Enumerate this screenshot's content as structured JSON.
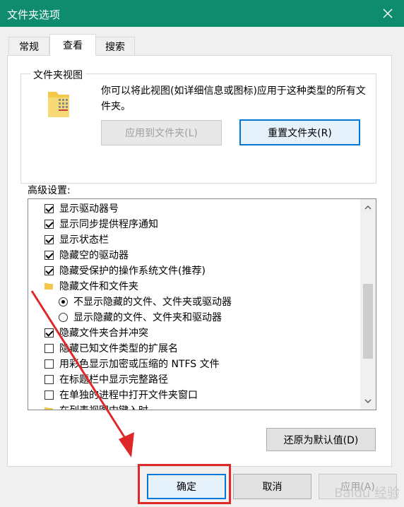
{
  "window": {
    "title": "文件夹选项"
  },
  "tabs": [
    {
      "label": "常规"
    },
    {
      "label": "查看"
    },
    {
      "label": "搜索"
    }
  ],
  "folder_views": {
    "legend": "文件夹视图",
    "description": "你可以将此视图(如详细信息或图标)应用于这种类型的所有文件夹。",
    "apply_button": "应用到文件夹(L)",
    "reset_button": "重置文件夹(R)"
  },
  "advanced": {
    "label": "高级设置:",
    "items": [
      {
        "label": "显示驱动器号",
        "kind": "checkbox",
        "checked": true
      },
      {
        "label": "显示同步提供程序通知",
        "kind": "checkbox",
        "checked": true
      },
      {
        "label": "显示状态栏",
        "kind": "checkbox",
        "checked": true
      },
      {
        "label": "隐藏空的驱动器",
        "kind": "checkbox",
        "checked": true
      },
      {
        "label": "隐藏受保护的操作系统文件(推荐)",
        "kind": "checkbox",
        "checked": true
      },
      {
        "label": "隐藏文件和文件夹",
        "kind": "folder"
      },
      {
        "label": "不显示隐藏的文件、文件夹或驱动器",
        "kind": "radio",
        "checked": true
      },
      {
        "label": "显示隐藏的文件、文件夹和驱动器",
        "kind": "radio",
        "checked": false
      },
      {
        "label": "隐藏文件夹合并冲突",
        "kind": "checkbox",
        "checked": true
      },
      {
        "label": "隐藏已知文件类型的扩展名",
        "kind": "checkbox",
        "checked": false
      },
      {
        "label": "用彩色显示加密或压缩的 NTFS 文件",
        "kind": "checkbox",
        "checked": false
      },
      {
        "label": "在标题栏中显示完整路径",
        "kind": "checkbox",
        "checked": false
      },
      {
        "label": "在单独的进程中打开文件夹窗口",
        "kind": "checkbox",
        "checked": false
      },
      {
        "label": "在列表视图中键入时",
        "kind": "folder"
      }
    ],
    "restore_button": "还原为默认值(D)"
  },
  "footer": {
    "ok_button": "确定",
    "cancel_button": "取消",
    "apply_button": "应用(A)"
  },
  "watermark": "Baidu 经验",
  "colors": {
    "titlebar": "#0f8c6e",
    "highlight": "#e02727",
    "accent": "#0078d7"
  }
}
